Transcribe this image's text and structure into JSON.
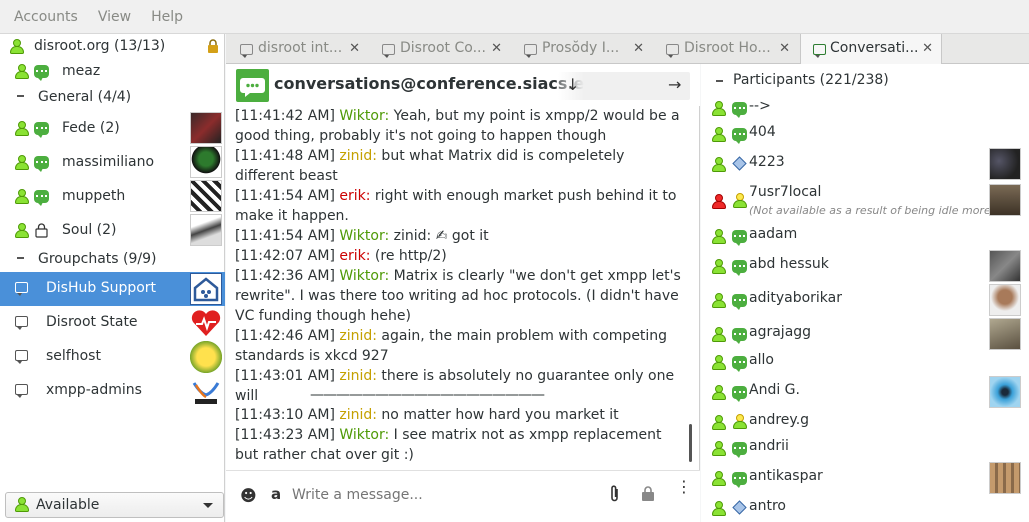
{
  "menu": {
    "accounts": "Accounts",
    "view": "View",
    "help": "Help"
  },
  "roster": {
    "account": "disroot.org (13/13)",
    "contact_meaz": "meaz",
    "group_general": "General (4/4)",
    "contacts": [
      {
        "label": "Fede (2)"
      },
      {
        "label": "massimiliano"
      },
      {
        "label": "muppeth"
      },
      {
        "label": "Soul (2)"
      }
    ],
    "group_groupchats": "Groupchats (9/9)",
    "groupchats": [
      {
        "label": "DisHub Support"
      },
      {
        "label": "Disroot State"
      },
      {
        "label": "selfhost"
      },
      {
        "label": "xmpp-admins"
      }
    ],
    "status": "Available"
  },
  "tabs": [
    {
      "label": "disroot int..."
    },
    {
      "label": "Disroot Co..."
    },
    {
      "label": "Prosŏdy I..."
    },
    {
      "label": "Disroot Ho..."
    },
    {
      "label": "Conversati..."
    }
  ],
  "chat": {
    "title": "conversations@conference.siacs.eu",
    "messages": [
      {
        "ts": "[11:41:42 AM]",
        "nick": "Wiktor:",
        "text": " Yeah, but my point is xmpp/2 would be a good thing, probably it's not going to happen though"
      },
      {
        "ts": "[11:41:48 AM]",
        "nick": "zinid:",
        "text": " but what Matrix did is compeletely different beast"
      },
      {
        "ts": "[11:41:54 AM]",
        "nick": "erik:",
        "text": " right with enough market push behind it to make it happen."
      },
      {
        "ts": "[11:41:54 AM]",
        "nick": "Wiktor:",
        "text": " zinid: ✍ got it"
      },
      {
        "ts": "[11:42:07 AM]",
        "nick": "erik:",
        "text": " (re http/2)"
      },
      {
        "ts": "[11:42:36 AM]",
        "nick": "Wiktor:",
        "text": " Matrix is clearly \"we don't get xmpp let's rewrite\". I was there too writing ad hoc protocols. (I didn't have VC funding though hehe)"
      },
      {
        "ts": "[11:42:46 AM]",
        "nick": "zinid:",
        "text": " again, the main problem with competing standards is xkcd 927"
      },
      {
        "ts": "[11:43:01 AM]",
        "nick": "zinid:",
        "text": " there is absolutely no guarantee only one will"
      },
      {
        "ts": "",
        "nick": "",
        "text": "——————————————————"
      },
      {
        "ts": "[11:43:10 AM]",
        "nick": "zinid:",
        "text": " no matter how hard you market it"
      },
      {
        "ts": "[11:43:23 AM]",
        "nick": "Wiktor:",
        "text": " I see matrix not as xmpp replacement but rather chat over git :)"
      }
    ],
    "composer_placeholder": "Write a message..."
  },
  "participants": {
    "header": "Participants (221/238)",
    "list": [
      {
        "name": "-->"
      },
      {
        "name": "404"
      },
      {
        "name": "4223"
      },
      {
        "name": "7usr7local",
        "note": "(Not available as a result of being idle more ..."
      },
      {
        "name": "aadam"
      },
      {
        "name": "abd hessuk"
      },
      {
        "name": "adityaborikar"
      },
      {
        "name": "agrajagg"
      },
      {
        "name": "allo"
      },
      {
        "name": "Andi G."
      },
      {
        "name": "andrey.g"
      },
      {
        "name": "andrii"
      },
      {
        "name": "antikaspar"
      },
      {
        "name": "antro"
      }
    ]
  },
  "colors": {
    "accent": "#4a90d9",
    "status_green": "#8ae234",
    "bubble_green": "#4cae3f"
  }
}
